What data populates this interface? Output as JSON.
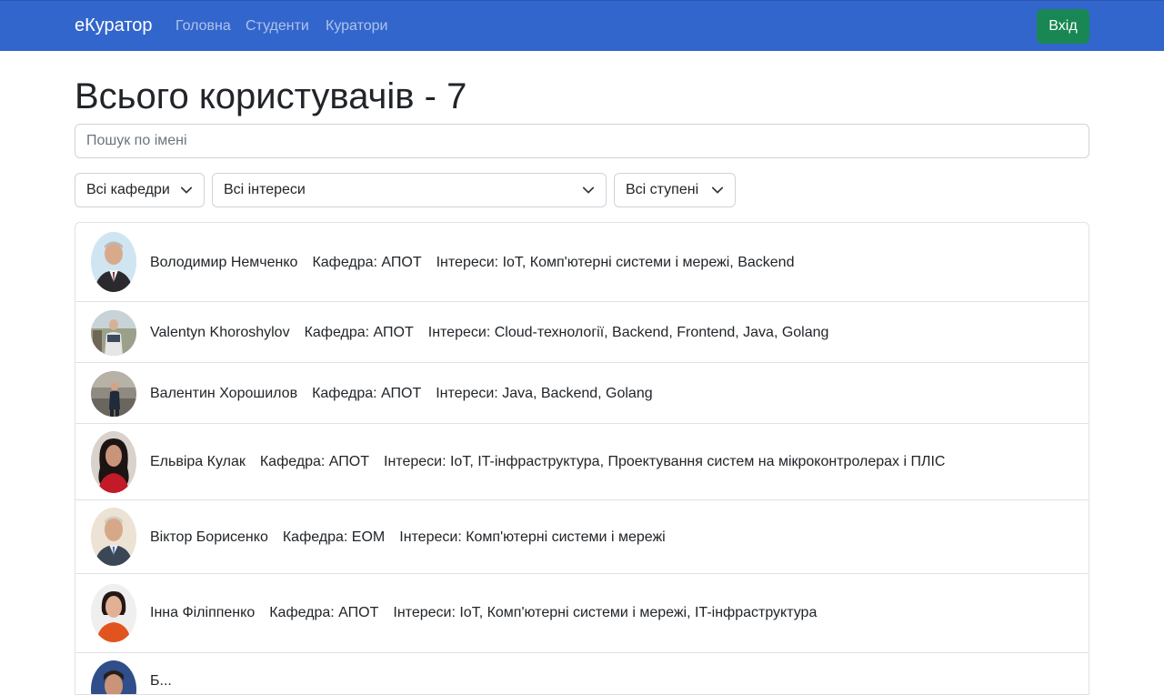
{
  "nav": {
    "brand": "еКуратор",
    "links": [
      "Головна",
      "Студенти",
      "Куратори"
    ],
    "login": "Вхід"
  },
  "title": "Всього користувачів - 7",
  "search": {
    "placeholder": "Пошук по імені",
    "value": ""
  },
  "filters": {
    "department": "Всі кафедри",
    "interests": "Всі інтереси",
    "degree": "Всі ступені"
  },
  "users": [
    {
      "name": "Володимир Немченко",
      "department": "Кафедра: АПОТ",
      "interests": "Інтереси: IoT, Комп'ютерні системи і мережі, Backend"
    },
    {
      "name": "Valentyn Khoroshylov",
      "department": "Кафедра: АПОТ",
      "interests": "Інтереси: Cloud-технології, Backend, Frontend, Java, Golang"
    },
    {
      "name": "Валентин Хорошилов",
      "department": "Кафедра: АПОТ",
      "interests": "Інтереси: Java, Backend, Golang"
    },
    {
      "name": "Ельвіра Кулак",
      "department": "Кафедра: АПОТ",
      "interests": "Інтереси: IoT, IT-інфраструктура, Проектування систем на мікроконтролерах і ПЛІС"
    },
    {
      "name": "Віктор Борисенко",
      "department": "Кафедра: ЕОМ",
      "interests": "Інтереси: Комп'ютерні системи і мережі"
    },
    {
      "name": "Інна Філіппенко",
      "department": "Кафедра: АПОТ",
      "interests": "Інтереси: IoT, Комп'ютерні системи і мережі, IT-інфраструктура"
    },
    {
      "name": "Б...",
      "department": "",
      "interests": ""
    }
  ],
  "colors": {
    "navbar": "#3366cc",
    "login_button": "#198754"
  }
}
